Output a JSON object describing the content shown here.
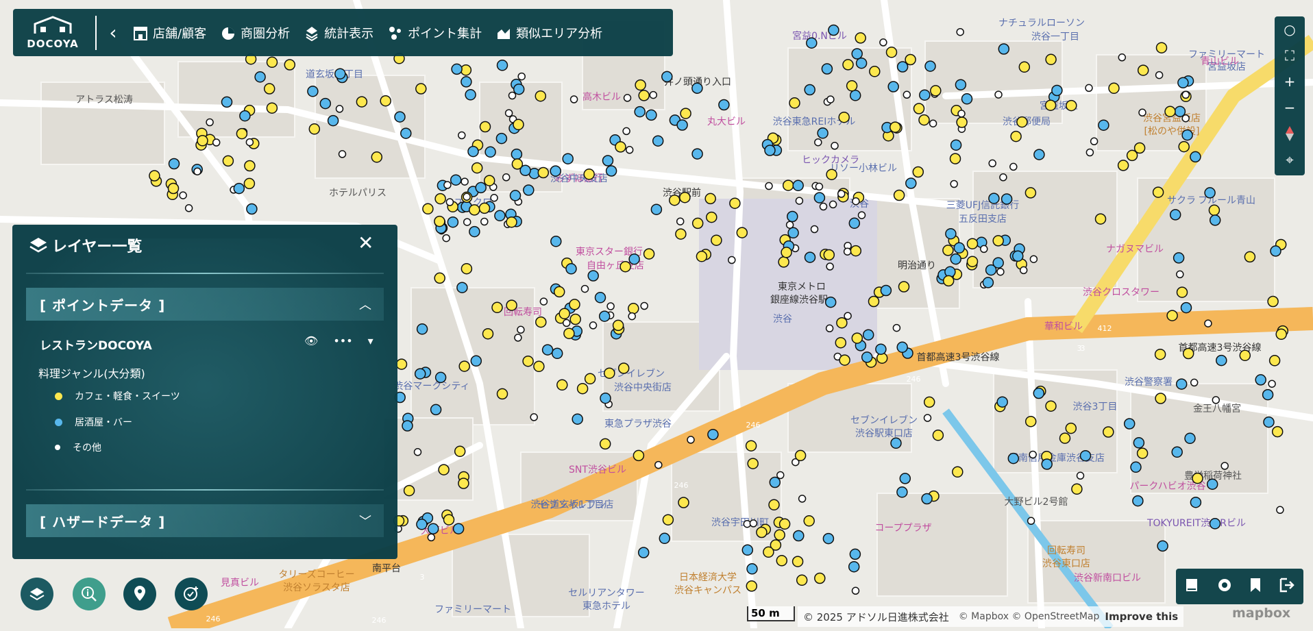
{
  "app": {
    "logo_text": "DOCOYA",
    "menu": [
      {
        "label": "店舗/顧客",
        "icon": "store-icon"
      },
      {
        "label": "商圏分析",
        "icon": "pie-chart-icon"
      },
      {
        "label": "統計表示",
        "icon": "layers-stack-icon"
      },
      {
        "label": "ポイント集計",
        "icon": "point-aggregate-icon"
      },
      {
        "label": "類似エリア分析",
        "icon": "area-chart-icon"
      }
    ]
  },
  "panel": {
    "title": "レイヤー一覧",
    "point_section": "[ ポイントデータ ]",
    "layer_name": "レストランDOCOYA",
    "group_label": "料理ジャンル(大分類)",
    "legend": [
      {
        "label": "カフェ・軽食・スイーツ",
        "color": "#fde84f"
      },
      {
        "label": "居酒屋・バー",
        "color": "#58b7ec"
      },
      {
        "label": "その他",
        "color": "#ffffff"
      }
    ],
    "hazard_section": "[ ハザードデータ ]"
  },
  "map": {
    "labels": [
      "宮益0.Nビル",
      "ナチュラルローソン",
      "渋谷一丁目",
      "ファミリーマート",
      "宮益坂店",
      "青山ビル",
      "アトラス松涛",
      "道玄坂二丁目",
      "井ノ頭通り入口",
      "高木ビル",
      "丸大ビル",
      "渋谷東急REIホテル",
      "宮益坂上",
      "渋谷郵便局",
      "渋谷宮益坂店",
      "[松のや併設]",
      "ホテルパリス",
      "みずほ銀行",
      "渋谷中央支店",
      "ヒックカメラ",
      "リソー小林ビル",
      "渋谷駅前",
      "渋谷",
      "三菱UFJ信託銀行",
      "五反田支店",
      "サクラ",
      "フルール青山",
      "ユニクロ",
      "東京スター銀行",
      "自由ヶ丘支店",
      "東京メトロ",
      "銀座線渋谷駅",
      "明治通り",
      "ナガヌマビル",
      "渋谷クロスタワー",
      "回転寿司",
      "渋谷マークシティ",
      "セブンイレブン",
      "渋谷中央街店",
      "首都高速3号渋谷線",
      "首都高速3号渋谷線",
      "渋谷警察署",
      "渋谷3丁目",
      "金王八幡宮",
      "東急プラザ渋谷",
      "セブンイレブン",
      "渋谷駅東口店",
      "城南信用金庫渋谷支店",
      "豊栄稲荷神社",
      "SNT渋谷ビル",
      "セブンイレブン",
      "渋谷道玄坂1丁目店",
      "パークハビオ渋谷",
      "TOKYUREIT渋谷Rビル",
      "大野ビル2号館",
      "コーププラザ",
      "渋谷宇田川町",
      "大下ビル",
      "回転寿司",
      "渋谷東口店",
      "渋谷新南口ビル",
      "タリーズコーヒー",
      "渋谷ソラスタ店",
      "日本経済大学",
      "渋谷キャンパス",
      "セルリアンタワー",
      "東急ホテル",
      "ファミリーマート",
      "南平台",
      "見真ビル",
      "華和ビル",
      "渋谷",
      "412",
      "246",
      "246",
      "246",
      "246",
      "246",
      "3",
      "3",
      "3",
      "246"
    ],
    "scale_label": "50 m",
    "copyright": "© 2025 アドソル日進株式会社",
    "mapbox_attr": "© Mapbox © OpenStreetMap",
    "improve": "Improve this",
    "brand": "mapbox"
  }
}
